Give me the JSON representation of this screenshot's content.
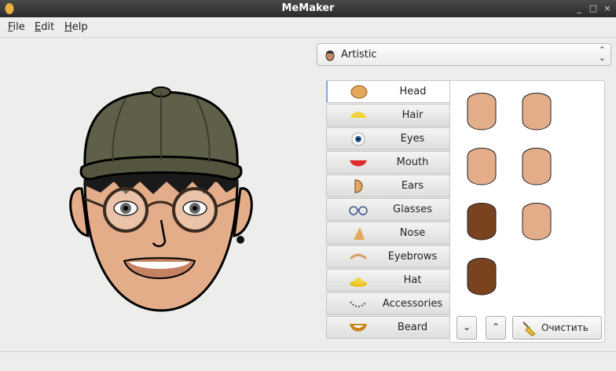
{
  "window": {
    "title": "MeMaker"
  },
  "menu": [
    {
      "label": "File",
      "accel": "F",
      "rest": "ile"
    },
    {
      "label": "Edit",
      "accel": "E",
      "rest": "dit"
    },
    {
      "label": "Help",
      "accel": "H",
      "rest": "elp"
    }
  ],
  "style_select": {
    "value": "Artistic"
  },
  "categories": [
    {
      "label": "Head",
      "icon": "head-icon"
    },
    {
      "label": "Hair",
      "icon": "hair-icon"
    },
    {
      "label": "Eyes",
      "icon": "eye-icon"
    },
    {
      "label": "Mouth",
      "icon": "mouth-icon"
    },
    {
      "label": "Ears",
      "icon": "ear-icon"
    },
    {
      "label": "Glasses",
      "icon": "glasses-icon"
    },
    {
      "label": "Nose",
      "icon": "nose-icon"
    },
    {
      "label": "Eyebrows",
      "icon": "eyebrow-icon"
    },
    {
      "label": "Hat",
      "icon": "hat-icon"
    },
    {
      "label": "Accessories",
      "icon": "accessories-icon"
    },
    {
      "label": "Beard",
      "icon": "beard-icon"
    }
  ],
  "selected_category": "Head",
  "head_options": [
    {
      "color": "#e3ad8a"
    },
    {
      "color": "#e3ad8a"
    },
    {
      "color": "#e3ad8a"
    },
    {
      "color": "#e3ad8a"
    },
    {
      "color": "#7a4320"
    },
    {
      "color": "#e3ad8a"
    },
    {
      "color": "#7a4320"
    }
  ],
  "buttons": {
    "down": "⌄",
    "up": "⌃",
    "clear": "Очистить"
  },
  "colors": {
    "skin": "#e3ad8a",
    "hat": "#5f5f4a",
    "hair": "#1a1a1a"
  }
}
